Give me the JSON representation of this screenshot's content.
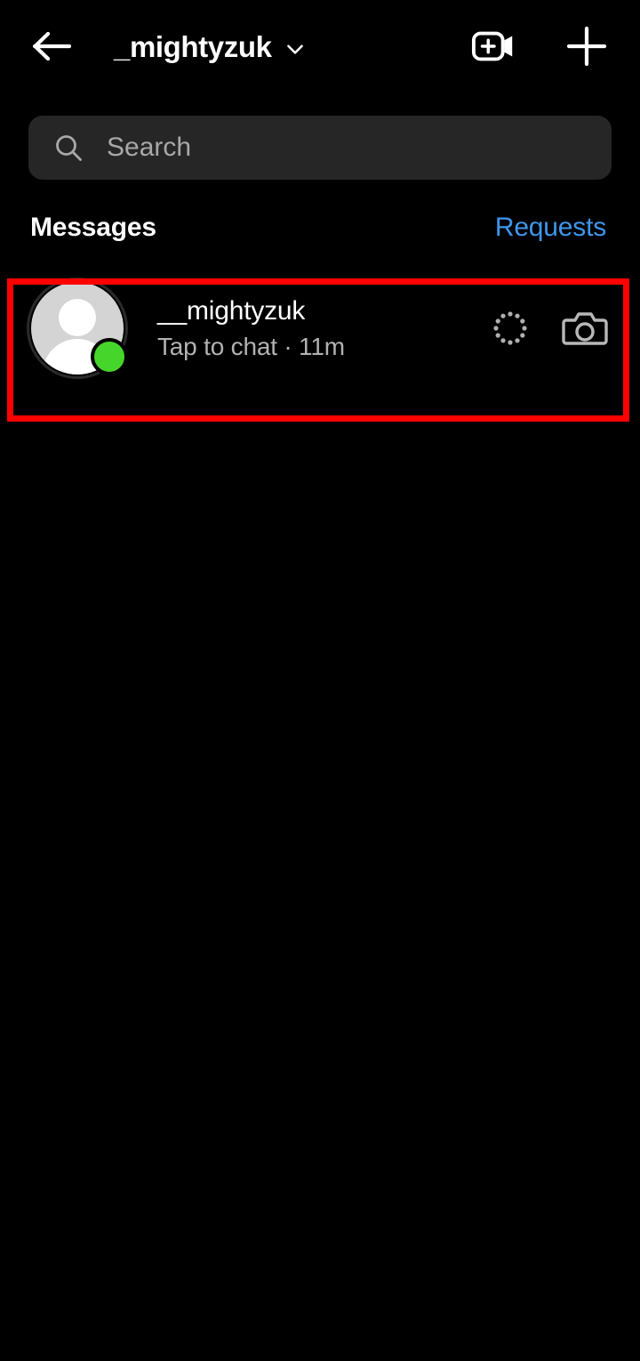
{
  "header": {
    "back_icon": "arrow-left-icon",
    "title": "_mightyzuk",
    "chevron_icon": "chevron-down-icon",
    "video_call_icon": "video-call-add-icon",
    "new_message_icon": "plus-icon"
  },
  "search": {
    "icon": "search-icon",
    "placeholder": "Search",
    "value": "",
    "background": "#262626"
  },
  "section": {
    "title": "Messages",
    "action_label": "Requests",
    "action_color": "#3f96ec"
  },
  "conversations": [
    {
      "name": "__mightyzuk",
      "subtitle": "Tap to chat · 11m",
      "preview_text": "Tap to chat",
      "timestamp": "11m",
      "avatar_icon": "default-person-avatar-icon",
      "online": true,
      "online_color": "#46d62b",
      "pending_icon": "dotted-circle-icon",
      "camera_icon": "camera-icon",
      "highlighted": true
    }
  ],
  "annotation": {
    "highlight_color": "#fe0000",
    "highlight_target": "conversation-row-mightyzuk"
  },
  "theme": {
    "background": "#000000",
    "text_primary": "#ffffff",
    "text_secondary": "#b2b2b2",
    "accent_blue": "#3f96ec"
  }
}
